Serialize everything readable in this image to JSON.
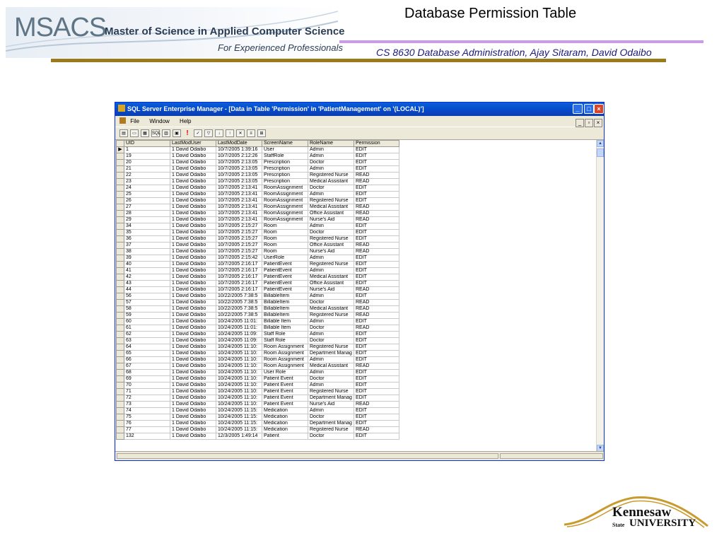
{
  "header": {
    "logo_acronym": "MSACS",
    "logo_line1": "Master of Science in Applied Computer Science",
    "logo_line2": "For Experienced Professionals",
    "title": "Database Permission Table",
    "subtitle": "CS 8630 Database Administration, Ajay Sitaram, David Odaibo"
  },
  "window": {
    "title": "SQL Server Enterprise Manager - [Data in Table 'Permission' in 'PatientManagement' on '(LOCAL)']",
    "menu": [
      "File",
      "Window",
      "Help"
    ],
    "toolbar_icons": [
      "properties-icon",
      "show-diagram-icon",
      "show-grid-icon",
      "sql-icon",
      "results-icon",
      "new-row-icon",
      "run-icon",
      "verify-sql-icon",
      "filter-icon",
      "sort-asc-icon",
      "sort-desc-icon",
      "remove-filter-icon",
      "group-by-icon",
      "add-table-icon"
    ],
    "toolbar_labels": {
      "sql": "SQL"
    }
  },
  "grid": {
    "columns": [
      "UID",
      "LastModUser",
      "LastModDate",
      "ScreenName",
      "RoleName",
      "Permission"
    ],
    "rows": [
      [
        "1",
        "1 David Odaibo",
        "10/7/2005 1:39:16",
        "User",
        "Admin",
        "EDIT"
      ],
      [
        "19",
        "1 David Odaibo",
        "10/7/2005 2:12:26",
        "StaffRole",
        "Admin",
        "EDIT"
      ],
      [
        "20",
        "1 David Odaibo",
        "10/7/2005 2:13:05",
        "Prescription",
        "Doctor",
        "EDIT"
      ],
      [
        "21",
        "1 David Odaibo",
        "10/7/2005 2:13:05",
        "Prescription",
        "Admin",
        "EDIT"
      ],
      [
        "22",
        "1 David Odaibo",
        "10/7/2005 2:13:05",
        "Prescription",
        "Registered Nurse",
        "READ"
      ],
      [
        "23",
        "1 David Odaibo",
        "10/7/2005 2:13:05",
        "Prescription",
        "Medical Assistant",
        "READ"
      ],
      [
        "24",
        "1 David Odaibo",
        "10/7/2005 2:13:41",
        "RoomAssignment",
        "Doctor",
        "EDIT"
      ],
      [
        "25",
        "1 David Odaibo",
        "10/7/2005 2:13:41",
        "RoomAssignment",
        "Admin",
        "EDIT"
      ],
      [
        "26",
        "1 David Odaibo",
        "10/7/2005 2:13:41",
        "RoomAssignment",
        "Registered Nurse",
        "EDIT"
      ],
      [
        "27",
        "1 David Odaibo",
        "10/7/2005 2:13:41",
        "RoomAssignment",
        "Medical Assistant",
        "READ"
      ],
      [
        "28",
        "1 David Odaibo",
        "10/7/2005 2:13:41",
        "RoomAssignment",
        "Office Assistant",
        "READ"
      ],
      [
        "29",
        "1 David Odaibo",
        "10/7/2005 2:13:41",
        "RoomAssignment",
        "Nurse's Aid",
        "READ"
      ],
      [
        "34",
        "1 David Odaibo",
        "10/7/2005 2:15:27",
        "Room",
        "Admin",
        "EDIT"
      ],
      [
        "35",
        "1 David Odaibo",
        "10/7/2005 2:15:27",
        "Room",
        "Doctor",
        "EDIT"
      ],
      [
        "36",
        "1 David Odaibo",
        "10/7/2005 2:15:27",
        "Room",
        "Registered Nurse",
        "EDIT"
      ],
      [
        "37",
        "1 David Odaibo",
        "10/7/2005 2:15:27",
        "Room",
        "Office Assistant",
        "READ"
      ],
      [
        "38",
        "1 David Odaibo",
        "10/7/2005 2:15:27",
        "Room",
        "Nurse's Aid",
        "READ"
      ],
      [
        "39",
        "1 David Odaibo",
        "10/7/2005 2:15:42",
        "UserRole",
        "Admin",
        "EDIT"
      ],
      [
        "40",
        "1 David Odaibo",
        "10/7/2005 2:16:17",
        "PatientEvent",
        "Registered Nurse",
        "EDIT"
      ],
      [
        "41",
        "1 David Odaibo",
        "10/7/2005 2:16:17",
        "PatientEvent",
        "Admin",
        "EDIT"
      ],
      [
        "42",
        "1 David Odaibo",
        "10/7/2005 2:16:17",
        "PatientEvent",
        "Medical Assistant",
        "EDIT"
      ],
      [
        "43",
        "1 David Odaibo",
        "10/7/2005 2:16:17",
        "PatientEvent",
        "Office Assistant",
        "EDIT"
      ],
      [
        "44",
        "1 David Odaibo",
        "10/7/2005 2:16:17",
        "PatientEvent",
        "Nurse's Aid",
        "READ"
      ],
      [
        "56",
        "1 David Odaibo",
        "10/22/2005 7:38:5",
        "BillableItem",
        "Admin",
        "EDIT"
      ],
      [
        "57",
        "1 David Odaibo",
        "10/22/2005 7:38:5",
        "BillableItem",
        "Doctor",
        "READ"
      ],
      [
        "58",
        "1 David Odaibo",
        "10/22/2005 7:38:5",
        "BillableItem",
        "Medical Assistant",
        "READ"
      ],
      [
        "59",
        "1 David Odaibo",
        "10/22/2005 7:38:5",
        "BillableItem",
        "Registered Nurse",
        "READ"
      ],
      [
        "60",
        "1 David Odaibo",
        "10/24/2005 11:01:",
        "Billable Item",
        "Admin",
        "EDIT"
      ],
      [
        "61",
        "1 David Odaibo",
        "10/24/2005 11:01:",
        "Billable Item",
        "Doctor",
        "READ"
      ],
      [
        "62",
        "1 David Odaibo",
        "10/24/2005 11:09:",
        "Staff Role",
        "Admin",
        "EDIT"
      ],
      [
        "63",
        "1 David Odaibo",
        "10/24/2005 11:09:",
        "Staff Role",
        "Doctor",
        "EDIT"
      ],
      [
        "64",
        "1 David Odaibo",
        "10/24/2005 11:10:",
        "Room Assignment",
        "Registered Nurse",
        "EDIT"
      ],
      [
        "65",
        "1 David Odaibo",
        "10/24/2005 11:10:",
        "Room Assignment",
        "Department Manag",
        "EDIT"
      ],
      [
        "66",
        "1 David Odaibo",
        "10/24/2005 11:10:",
        "Room Assignment",
        "Admin",
        "EDIT"
      ],
      [
        "67",
        "1 David Odaibo",
        "10/24/2005 11:10:",
        "Room Assignment",
        "Medical Assistant",
        "READ"
      ],
      [
        "68",
        "1 David Odaibo",
        "10/24/2005 11:10:",
        "User Role",
        "Admin",
        "EDIT"
      ],
      [
        "69",
        "1 David Odaibo",
        "10/24/2005 11:10:",
        "Patient Event",
        "Doctor",
        "EDIT"
      ],
      [
        "70",
        "1 David Odaibo",
        "10/24/2005 11:10:",
        "Patient Event",
        "Admin",
        "EDIT"
      ],
      [
        "71",
        "1 David Odaibo",
        "10/24/2005 11:10:",
        "Patient Event",
        "Registered Nurse",
        "EDIT"
      ],
      [
        "72",
        "1 David Odaibo",
        "10/24/2005 11:10:",
        "Patient Event",
        "Department Manag",
        "EDIT"
      ],
      [
        "73",
        "1 David Odaibo",
        "10/24/2005 11:10:",
        "Patient Event",
        "Nurse's Aid",
        "READ"
      ],
      [
        "74",
        "1 David Odaibo",
        "10/24/2005 11:15:",
        "Medication",
        "Admin",
        "EDIT"
      ],
      [
        "75",
        "1 David Odaibo",
        "10/24/2005 11:15:",
        "Medication",
        "Doctor",
        "EDIT"
      ],
      [
        "76",
        "1 David Odaibo",
        "10/24/2005 11:15:",
        "Medication",
        "Department Manag",
        "EDIT"
      ],
      [
        "77",
        "1 David Odaibo",
        "10/24/2005 11:15:",
        "Medication",
        "Registered Nurse",
        "READ"
      ],
      [
        "132",
        "1 David Odaibo",
        "12/3/2005 1:49:14",
        "Patient",
        "Doctor",
        "EDIT"
      ]
    ]
  },
  "footer": {
    "logo_name": "Kennesaw",
    "logo_state": "State",
    "logo_university": "UNIVERSITY"
  },
  "colors": {
    "titlebar": "#0648c8",
    "purple_rule": "#cc99ee",
    "gold_rule": "#9a7a1c",
    "subtitle": "#1a1a7a"
  }
}
